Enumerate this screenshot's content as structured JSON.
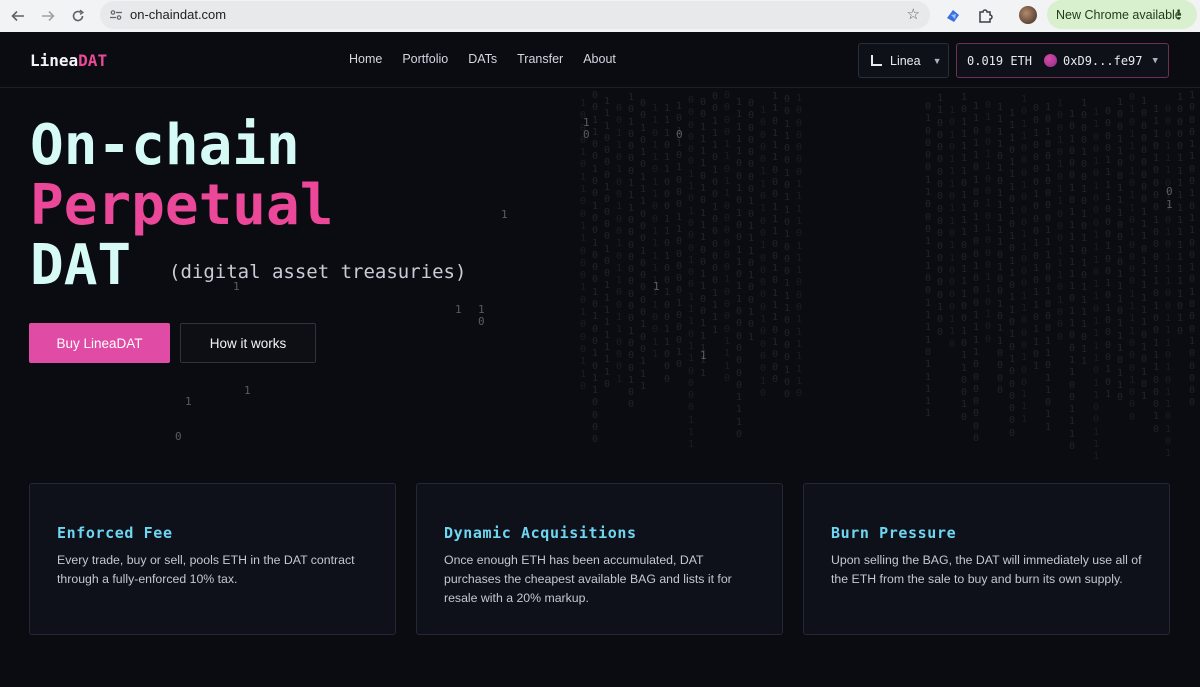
{
  "browser": {
    "url": "on-chaindat.com",
    "update_label": "New Chrome available",
    "icons": [
      "back-arrow-icon",
      "forward-arrow-icon",
      "reload-icon",
      "site-info-icon",
      "bookmark-star-icon",
      "extension-icon",
      "puzzle-icon",
      "profile-avatar",
      "menu-dots-icon"
    ]
  },
  "header": {
    "logo_main": "Linea",
    "logo_accent": "DAT",
    "nav": [
      "Home",
      "Portfolio",
      "DATs",
      "Transfer",
      "About"
    ],
    "network_label": "Linea",
    "wallet_balance": "0.019 ETH",
    "wallet_address": "0xD9...fe97"
  },
  "hero": {
    "line1": "On-chain",
    "line2": "Perpetual",
    "line3": "DAT",
    "subtitle": "(digital asset treasuries)",
    "buy_label": "Buy LineaDAT",
    "how_label": "How it works"
  },
  "features": [
    {
      "title": "Enforced Fee",
      "body": "Every trade, buy or sell, pools ETH in the DAT contract through a fully-enforced 10% tax."
    },
    {
      "title": "Dynamic Acquisitions",
      "body": "Once enough ETH has been accumulated, DAT purchases the cheapest available BAG and lists it for resale with a 20% markup."
    },
    {
      "title": "Burn Pressure",
      "body": "Upon selling the BAG, the DAT will immediately use all of the ETH from the sale to buy and burn its own supply."
    }
  ],
  "colors": {
    "accent_pink": "#ec4899",
    "heading_cyan": "#d6fbf6",
    "card_title_blue": "#6fd6f2",
    "background": "#0b0c12"
  }
}
